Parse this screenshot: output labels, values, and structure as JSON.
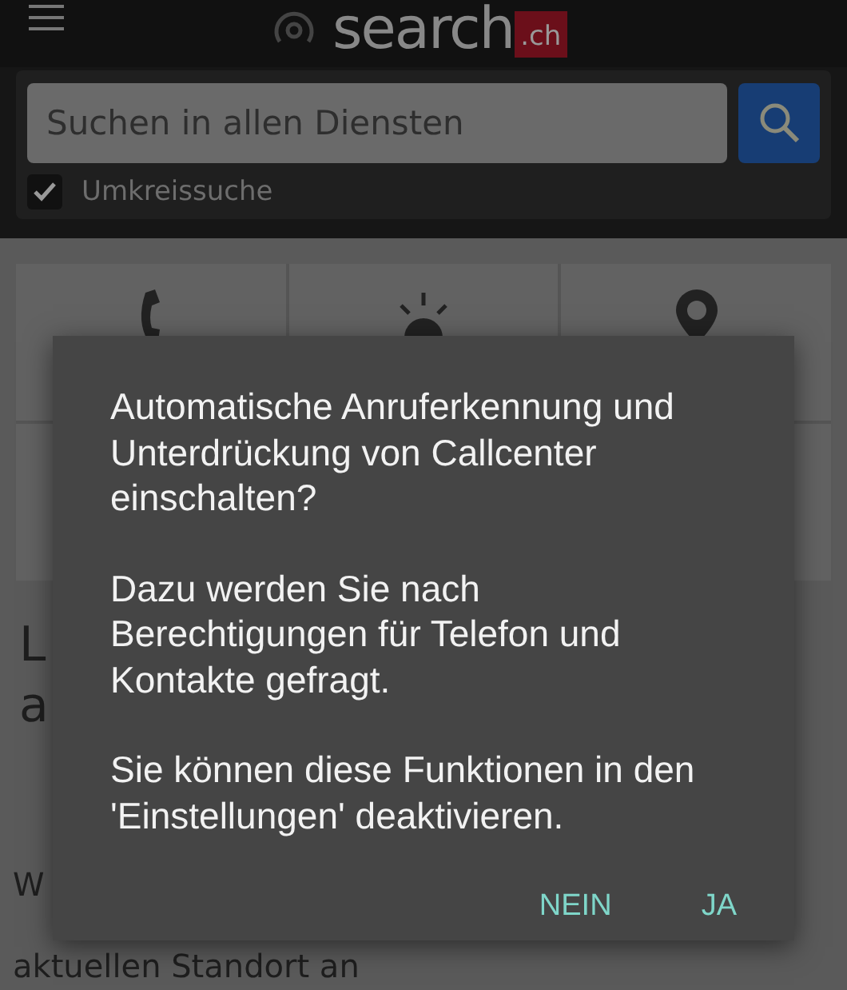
{
  "header": {
    "logo_text": "search",
    "logo_badge": ".ch"
  },
  "search": {
    "placeholder": "Suchen in allen Diensten",
    "option": {
      "label": "Umkreissuche",
      "checked": true
    }
  },
  "tiles": [
    {
      "kind": "phone"
    },
    {
      "kind": "sun"
    },
    {
      "kind": "pin"
    }
  ],
  "heading_lines": [
    "L",
    "a"
  ],
  "paragraph_lines": [
    "W",
    "aktuellen Standort an"
  ],
  "dialog": {
    "paragraphs": [
      "Automatische Anruferkennung und Unterdrückung von Callcenter einschalten?",
      "Dazu werden Sie nach Berechtigungen für Telefon und Kontakte gefragt.",
      "Sie können diese Funktionen in den 'Einstellungen' deaktivieren."
    ],
    "buttons": [
      {
        "label": "NEIN"
      },
      {
        "label": "JA"
      }
    ]
  }
}
